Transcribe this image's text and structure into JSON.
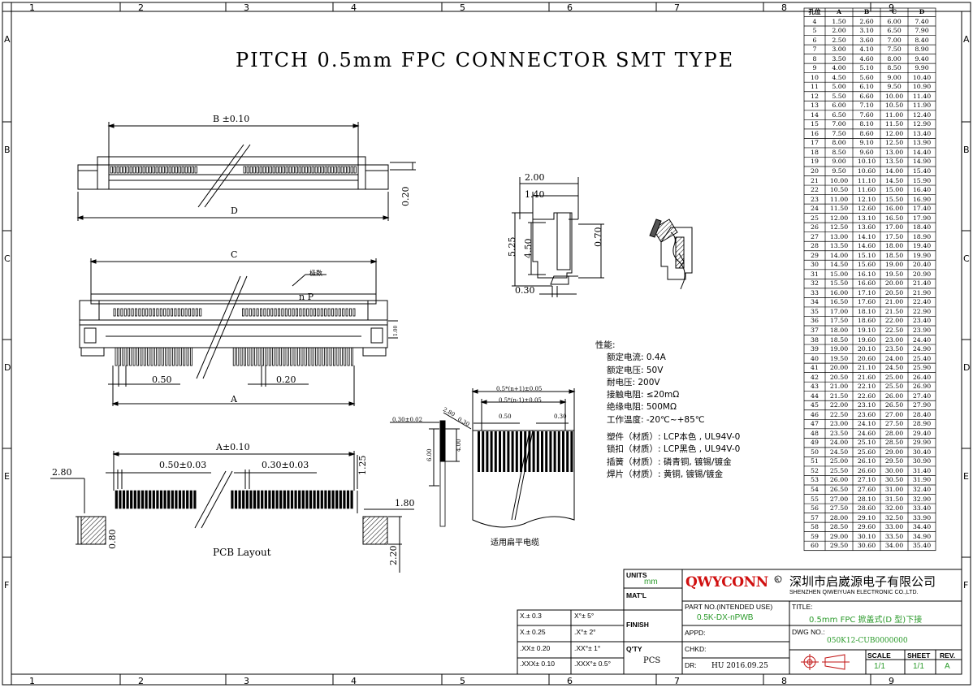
{
  "title": "PITCH 0.5mm FPC CONNECTOR SMT TYPE",
  "colors": {
    "accent_green": "#2a9a2a",
    "logo_red": "#d01010",
    "line": "#000000"
  },
  "border": {
    "columns": [
      "1",
      "2",
      "3",
      "4",
      "5",
      "6",
      "7",
      "8",
      "9"
    ],
    "rows": [
      "A",
      "B",
      "C",
      "D",
      "E",
      "F"
    ]
  },
  "top_view": {
    "dim_b": "B ±0.10",
    "dim_d": "D",
    "dim_side": "0.20"
  },
  "front_view": {
    "dim_c": "C",
    "dim_a": "A",
    "pitch_label": "n P",
    "pin_count_label": "极数",
    "dim_050": "0.50",
    "dim_020": "0.20",
    "dim_small": "1.00"
  },
  "pcb_layout": {
    "caption": "PCB Layout",
    "dim_a": "A±0.10",
    "dim_pitch": "0.50±0.03",
    "dim_pad": "0.30±0.03",
    "dim_280": "2.80",
    "dim_125": "1.25",
    "dim_180": "1.80",
    "dim_080": "0.80",
    "dim_220": "2.20"
  },
  "side_view": {
    "dim_200": "2.00",
    "dim_140": "1.40",
    "dim_525": "5.25",
    "dim_450": "4.50",
    "dim_070": "0.70",
    "dim_030": "0.30"
  },
  "fpc_view": {
    "caption": "适用扁平电缆",
    "dim_top1": "0.5*(n+1)±0.05",
    "dim_top2": "0.5*(n-1)±0.05",
    "dim_050": "0.50",
    "dim_030": "0.30",
    "dim_left_thk": "0.30±0.02",
    "dim_280": "2.80",
    "dim_030b": "0.30",
    "dim_600": "6.00",
    "dim_400": "4.00"
  },
  "specs": {
    "heading": "性能:",
    "electrical": [
      "额定电流: 0.4A",
      "额定电压: 50V",
      "耐电压: 200V",
      "接触电阻: ≤20mΩ",
      "绝缘电阻: 500MΩ",
      "工作温度: -20℃~+85℃"
    ],
    "materials": [
      "塑件（材质）: LCP本色 , UL94V-0",
      "锁扣（材质）: LCP黑色 , UL94V-0",
      "插簧（材质）: 磷青铜, 镀锡/镀金",
      "焊片（材质）: 黄铜, 镀锡/镀金"
    ]
  },
  "dim_table": {
    "headers": [
      "孔位",
      "A",
      "B",
      "C",
      "D"
    ],
    "rows": [
      [
        "4",
        "1.50",
        "2.60",
        "6.00",
        "7.40"
      ],
      [
        "5",
        "2.00",
        "3.10",
        "6.50",
        "7.90"
      ],
      [
        "6",
        "2.50",
        "3.60",
        "7.00",
        "8.40"
      ],
      [
        "7",
        "3.00",
        "4.10",
        "7.50",
        "8.90"
      ],
      [
        "8",
        "3.50",
        "4.60",
        "8.00",
        "9.40"
      ],
      [
        "9",
        "4.00",
        "5.10",
        "8.50",
        "9.90"
      ],
      [
        "10",
        "4.50",
        "5.60",
        "9.00",
        "10.40"
      ],
      [
        "11",
        "5.00",
        "6.10",
        "9.50",
        "10.90"
      ],
      [
        "12",
        "5.50",
        "6.60",
        "10.00",
        "11.40"
      ],
      [
        "13",
        "6.00",
        "7.10",
        "10.50",
        "11.90"
      ],
      [
        "14",
        "6.50",
        "7.60",
        "11.00",
        "12.40"
      ],
      [
        "15",
        "7.00",
        "8.10",
        "11.50",
        "12.90"
      ],
      [
        "16",
        "7.50",
        "8.60",
        "12.00",
        "13.40"
      ],
      [
        "17",
        "8.00",
        "9.10",
        "12.50",
        "13.90"
      ],
      [
        "18",
        "8.50",
        "9.60",
        "13.00",
        "14.40"
      ],
      [
        "19",
        "9.00",
        "10.10",
        "13.50",
        "14.90"
      ],
      [
        "20",
        "9.50",
        "10.60",
        "14.00",
        "15.40"
      ],
      [
        "21",
        "10.00",
        "11.10",
        "14.50",
        "15.90"
      ],
      [
        "22",
        "10.50",
        "11.60",
        "15.00",
        "16.40"
      ],
      [
        "23",
        "11.00",
        "12.10",
        "15.50",
        "16.90"
      ],
      [
        "24",
        "11.50",
        "12.60",
        "16.00",
        "17.40"
      ],
      [
        "25",
        "12.00",
        "13.10",
        "16.50",
        "17.90"
      ],
      [
        "26",
        "12.50",
        "13.60",
        "17.00",
        "18.40"
      ],
      [
        "27",
        "13.00",
        "14.10",
        "17.50",
        "18.90"
      ],
      [
        "28",
        "13.50",
        "14.60",
        "18.00",
        "19.40"
      ],
      [
        "29",
        "14.00",
        "15.10",
        "18.50",
        "19.90"
      ],
      [
        "30",
        "14.50",
        "15.60",
        "19.00",
        "20.40"
      ],
      [
        "31",
        "15.00",
        "16.10",
        "19.50",
        "20.90"
      ],
      [
        "32",
        "15.50",
        "16.60",
        "20.00",
        "21.40"
      ],
      [
        "33",
        "16.00",
        "17.10",
        "20.50",
        "21.90"
      ],
      [
        "34",
        "16.50",
        "17.60",
        "21.00",
        "22.40"
      ],
      [
        "35",
        "17.00",
        "18.10",
        "21.50",
        "22.90"
      ],
      [
        "36",
        "17.50",
        "18.60",
        "22.00",
        "23.40"
      ],
      [
        "37",
        "18.00",
        "19.10",
        "22.50",
        "23.90"
      ],
      [
        "38",
        "18.50",
        "19.60",
        "23.00",
        "24.40"
      ],
      [
        "39",
        "19.00",
        "20.10",
        "23.50",
        "24.90"
      ],
      [
        "40",
        "19.50",
        "20.60",
        "24.00",
        "25.40"
      ],
      [
        "41",
        "20.00",
        "21.10",
        "24.50",
        "25.90"
      ],
      [
        "42",
        "20.50",
        "21.60",
        "25.00",
        "26.40"
      ],
      [
        "43",
        "21.00",
        "22.10",
        "25.50",
        "26.90"
      ],
      [
        "44",
        "21.50",
        "22.60",
        "26.00",
        "27.40"
      ],
      [
        "45",
        "22.00",
        "23.10",
        "26.50",
        "27.90"
      ],
      [
        "46",
        "22.50",
        "23.60",
        "27.00",
        "28.40"
      ],
      [
        "47",
        "23.00",
        "24.10",
        "27.50",
        "28.90"
      ],
      [
        "48",
        "23.50",
        "24.60",
        "28.00",
        "29.40"
      ],
      [
        "49",
        "24.00",
        "25.10",
        "28.50",
        "29.90"
      ],
      [
        "50",
        "24.50",
        "25.60",
        "29.00",
        "30.40"
      ],
      [
        "51",
        "25.00",
        "26.10",
        "29.50",
        "30.90"
      ],
      [
        "52",
        "25.50",
        "26.60",
        "30.00",
        "31.40"
      ],
      [
        "53",
        "26.00",
        "27.10",
        "30.50",
        "31.90"
      ],
      [
        "54",
        "26.50",
        "27.60",
        "31.00",
        "32.40"
      ],
      [
        "55",
        "27.00",
        "28.10",
        "31.50",
        "32.90"
      ],
      [
        "56",
        "27.50",
        "28.60",
        "32.00",
        "33.40"
      ],
      [
        "57",
        "28.00",
        "29.10",
        "32.50",
        "33.90"
      ],
      [
        "58",
        "28.50",
        "29.60",
        "33.00",
        "34.40"
      ],
      [
        "59",
        "29.00",
        "30.10",
        "33.50",
        "34.90"
      ],
      [
        "60",
        "29.50",
        "30.60",
        "34.00",
        "35.40"
      ]
    ]
  },
  "tolerances": [
    [
      "X.± 0.3",
      "X°± 5°"
    ],
    [
      "X.± 0.25",
      ".X°± 2°"
    ],
    [
      ".XX± 0.20",
      ".XX°± 1°"
    ],
    [
      ".XXX± 0.10",
      ".XXX°± 0.5°"
    ]
  ],
  "title_block": {
    "units_label": "UNITS",
    "units_value": "mm",
    "matl_label": "MAT'L",
    "finish_label": "FINISH",
    "qty_label": "Q'TY",
    "qty_value": "PCS",
    "logo": "QWYCONN",
    "company_cn": "深圳市启崴源电子有限公司",
    "company_en": "SHENZHEN QIWEIYUAN ELECTRONIC CO.,LTD.",
    "part_no_label": "PART NO.(INTENDED USE)",
    "part_no_value": "0.5K-DX-nPWB",
    "title_label": "TITLE:",
    "title_value": "0.5mm FPC 掀盖式(D 型)下接",
    "appd_label": "APPD:",
    "chkd_label": "CHKD:",
    "dr_label": "DR:",
    "dr_value": "HU  2016.09.25",
    "dwg_label": "DWG NO.:",
    "dwg_value": "050K12-CUB0000000",
    "scale_label": "SCALE",
    "scale_value": "1/1",
    "sheet_label": "SHEET",
    "sheet_value": "1/1",
    "rev_label": "REV.",
    "rev_value": "A"
  }
}
